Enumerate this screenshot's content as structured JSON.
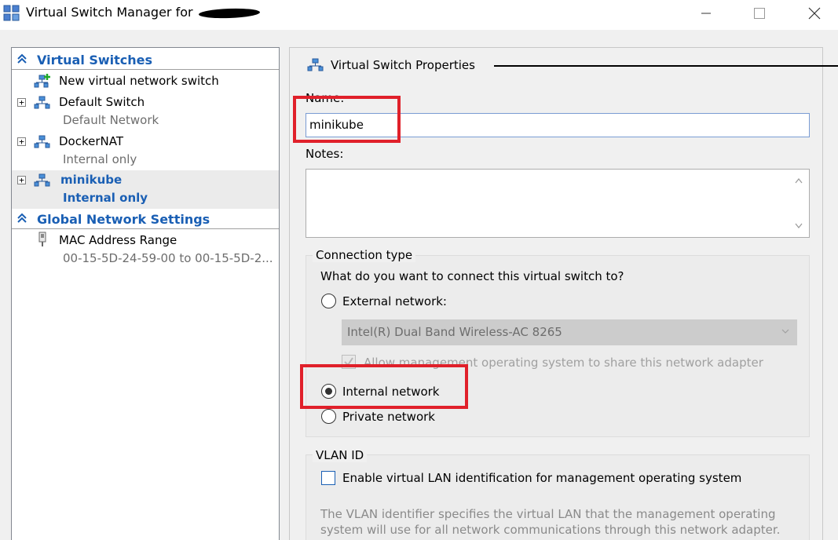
{
  "window": {
    "title": "Virtual Switch Manager for"
  },
  "left_pane": {
    "virtual_switches_header": "Virtual Switches",
    "new_switch_label": "New virtual network switch",
    "switches": [
      {
        "name": "Default Switch",
        "type": "Default Network"
      },
      {
        "name": "DockerNAT",
        "type": "Internal only"
      },
      {
        "name": "minikube",
        "type": "Internal only"
      }
    ],
    "global_header": "Global Network Settings",
    "mac_range_label": "MAC Address Range",
    "mac_range_value": "00-15-5D-24-59-00 to 00-15-5D-2..."
  },
  "properties": {
    "header": "Virtual Switch Properties",
    "name_label": "Name:",
    "name_value": "minikube",
    "notes_label": "Notes:",
    "connection_type": {
      "title": "Connection type",
      "question": "What do you want to connect this virtual switch to?",
      "external_label": "External network:",
      "external_adapter": "Intel(R) Dual Band Wireless-AC 8265",
      "allow_mgmt_label": "Allow management operating system to share this network adapter",
      "internal_label": "Internal network",
      "private_label": "Private network",
      "selected": "internal"
    },
    "vlan": {
      "title": "VLAN ID",
      "enable_label": "Enable virtual LAN identification for management operating system",
      "description_line1": "The VLAN identifier specifies the virtual LAN that the management operating",
      "description_line2": "system will use for all network communications through this network adapter. This"
    }
  },
  "colors": {
    "accent_blue": "#1a5fb4",
    "highlight_red": "#e0202a"
  }
}
